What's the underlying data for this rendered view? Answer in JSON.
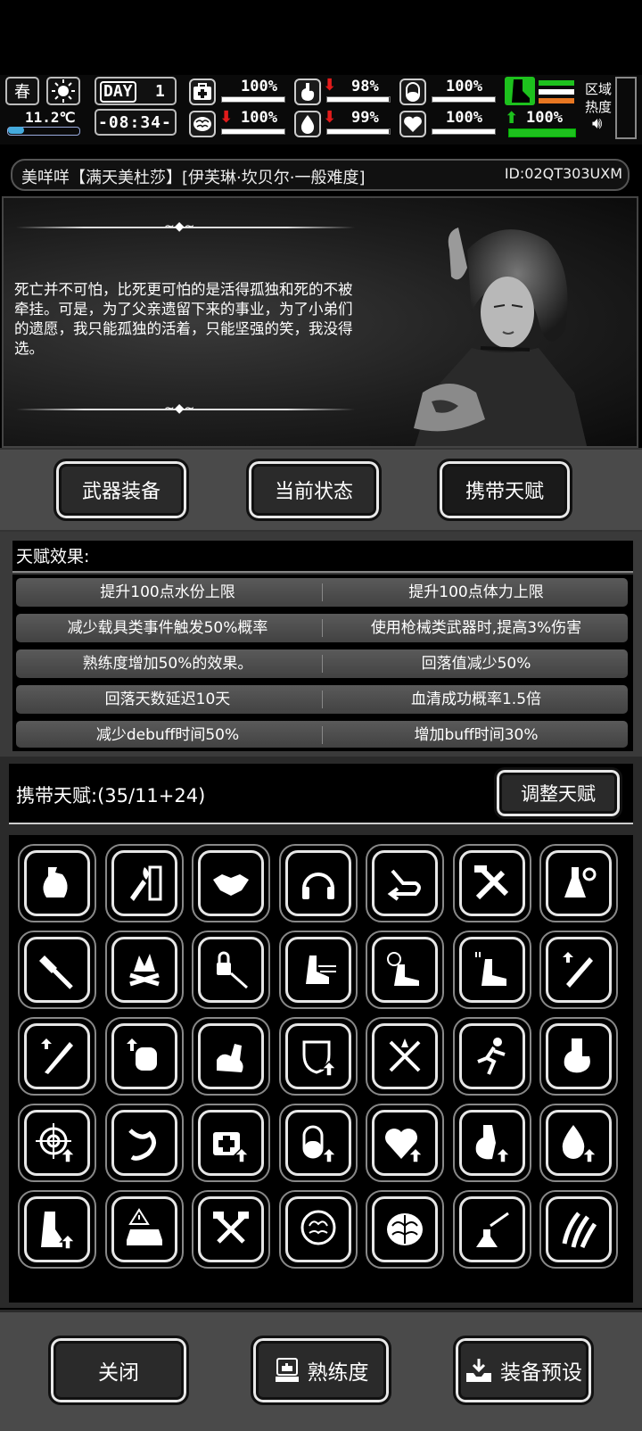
{
  "hud": {
    "season": "春",
    "weather_icon": "sun-icon",
    "temperature": "11.2℃",
    "day_label": "DAY",
    "day_number": "1",
    "time": "-08:34-",
    "stats": [
      {
        "name": "health",
        "icon": "medkit-icon",
        "value": "100%",
        "level": 1.0,
        "trend": ""
      },
      {
        "name": "hunger",
        "icon": "stomach-icon",
        "value": "98%",
        "level": 0.98,
        "trend": "down"
      },
      {
        "name": "stamina",
        "icon": "pill-icon",
        "value": "100%",
        "level": 1.0,
        "trend": ""
      },
      {
        "name": "mental",
        "icon": "brain-icon",
        "value": "100%",
        "level": 1.0,
        "trend": "down"
      },
      {
        "name": "thirst",
        "icon": "water-drop-icon",
        "value": "99%",
        "level": 0.99,
        "trend": "down"
      },
      {
        "name": "mood",
        "icon": "heart-icon",
        "value": "100%",
        "level": 1.0,
        "trend": ""
      },
      {
        "name": "legs",
        "icon": "boot-icon",
        "value": "100%",
        "level": 1.0,
        "trend": "up"
      }
    ],
    "region_label": "区域",
    "heat_label": "热度",
    "sound_icon": "speaker-icon"
  },
  "title": {
    "text": "美咩咩【满天美杜莎】[伊芙琳·坎贝尔·一般难度]",
    "id": "ID:02QT303UXM"
  },
  "portrait": {
    "quote": "死亡并不可怕，比死更可怕的是活得孤独和死的不被牵挂。可是，为了父亲遗留下来的事业，为了小弟们的遗愿，我只能孤独的活着，只能坚强的笑，我没得选。",
    "wardrobe_icon": "swap-outfit-icon"
  },
  "tabs": [
    "武器装备",
    "当前状态",
    "携带天赋"
  ],
  "effects": {
    "header": "天赋效果:",
    "rows": [
      [
        "提升100点水份上限",
        "提升100点体力上限"
      ],
      [
        "减少载具类事件触发50%概率",
        "使用枪械类武器时,提高3%伤害"
      ],
      [
        "熟练度增加50%的效果。",
        "回落值减少50%"
      ],
      [
        "回落天数延迟10天",
        "血清成功概率1.5倍"
      ],
      [
        "减少debuff时间50%",
        "增加buff时间30%"
      ]
    ]
  },
  "carry": {
    "label": "携带天赋:(35/11+24)",
    "adjust": "调整天赋"
  },
  "talents": [
    "water-bag-icon",
    "fire-torch-icon",
    "handshake-icon",
    "headphones-icon",
    "return-arrow-icon",
    "hammer-wrench-icon",
    "chemistry-flask-icon",
    "axe-craft-icon",
    "bonfire-icon",
    "lock-pick-icon",
    "speed-boot-icon",
    "speed-clock-icon",
    "speed-up-icon",
    "blade-up-icon",
    "bat-up-icon",
    "fist-up-icon",
    "muscle-arm-icon",
    "shield-up-icon",
    "crossed-swords-icon",
    "running-man-icon",
    "stomach-boost-icon",
    "target-up-icon",
    "throat-icon",
    "medkit-up-icon",
    "pill-up-icon",
    "heart-up-icon",
    "stomach-up-icon",
    "water-up-icon",
    "leg-up-icon",
    "car-warning-icon",
    "crossed-hammers-icon",
    "brain-head-icon",
    "brain-icon",
    "syringe-flask-icon",
    "claw-marks-icon"
  ],
  "bottom": {
    "close": "关闭",
    "proficiency": "熟练度",
    "preset": "装备预设"
  }
}
